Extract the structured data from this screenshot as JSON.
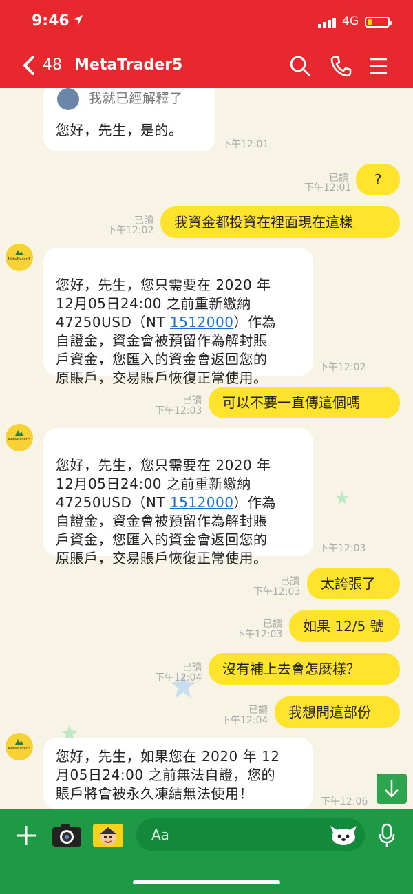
{
  "status_bar": {
    "time": "9:46",
    "network": "4G"
  },
  "header": {
    "unread_count": "48",
    "title": "MetaTrader5"
  },
  "messages": [
    {
      "id": "quoted_reply",
      "text": "我就已經解釋了",
      "reply": "您好，先生，是的。",
      "time": "下午12:01"
    },
    {
      "id": "m1",
      "text": "?",
      "read": "已讀",
      "time": "下午12:01"
    },
    {
      "id": "m2",
      "text": "我資金都投資在裡面現在這樣",
      "read": "已讀",
      "time": "下午12:02"
    },
    {
      "id": "m3",
      "pre": "您好，先生，您只需要在 2020 年\n12月05日24:00 之前重新繳納\n47250USD（NT ",
      "link": "1512000",
      "post": "）作為\n自證金，資金會被預留作為解封賬\n戶資金，您匯入的資金會返回您的\n原賬戶，交易賬戶恢復正常使用。",
      "time": "下午12:02"
    },
    {
      "id": "m4",
      "text": "可以不要一直傳這個嗎",
      "read": "已讀",
      "time": "下午12:03"
    },
    {
      "id": "m5",
      "pre": "您好，先生，您只需要在 2020 年\n12月05日24:00 之前重新繳納\n47250USD（NT ",
      "link": "1512000",
      "post": "）作為\n自證金，資金會被預留作為解封賬\n戶資金，您匯入的資金會返回您的\n原賬戶，交易賬戶恢復正常使用。",
      "time": "下午12:03"
    },
    {
      "id": "m6",
      "text": "太誇張了",
      "read": "已讀",
      "time": "下午12:03"
    },
    {
      "id": "m7",
      "text": "如果 12/5 號",
      "read": "已讀",
      "time": "下午12:03"
    },
    {
      "id": "m8",
      "text": "沒有補上去會怎麼樣？",
      "read": "已讀",
      "time": "下午12:04"
    },
    {
      "id": "m9",
      "text": "我想問這部份",
      "read": "已讀",
      "time": "下午12:04"
    },
    {
      "id": "m10",
      "text": "您好，先生，如果您在 2020 年 12\n月05日24:00 之前無法自證，您的\n賬戶將會被永久凍結無法使用！",
      "time": "下午12:06"
    }
  ],
  "avatar_text": "MetaTrader 5",
  "input": {
    "placeholder": "Aa"
  },
  "colors": {
    "header": "#e7292f",
    "footer": "#1e9a46",
    "outgoing_bubble": "#ffe32c",
    "chat_bg": "#f7f4e6"
  }
}
